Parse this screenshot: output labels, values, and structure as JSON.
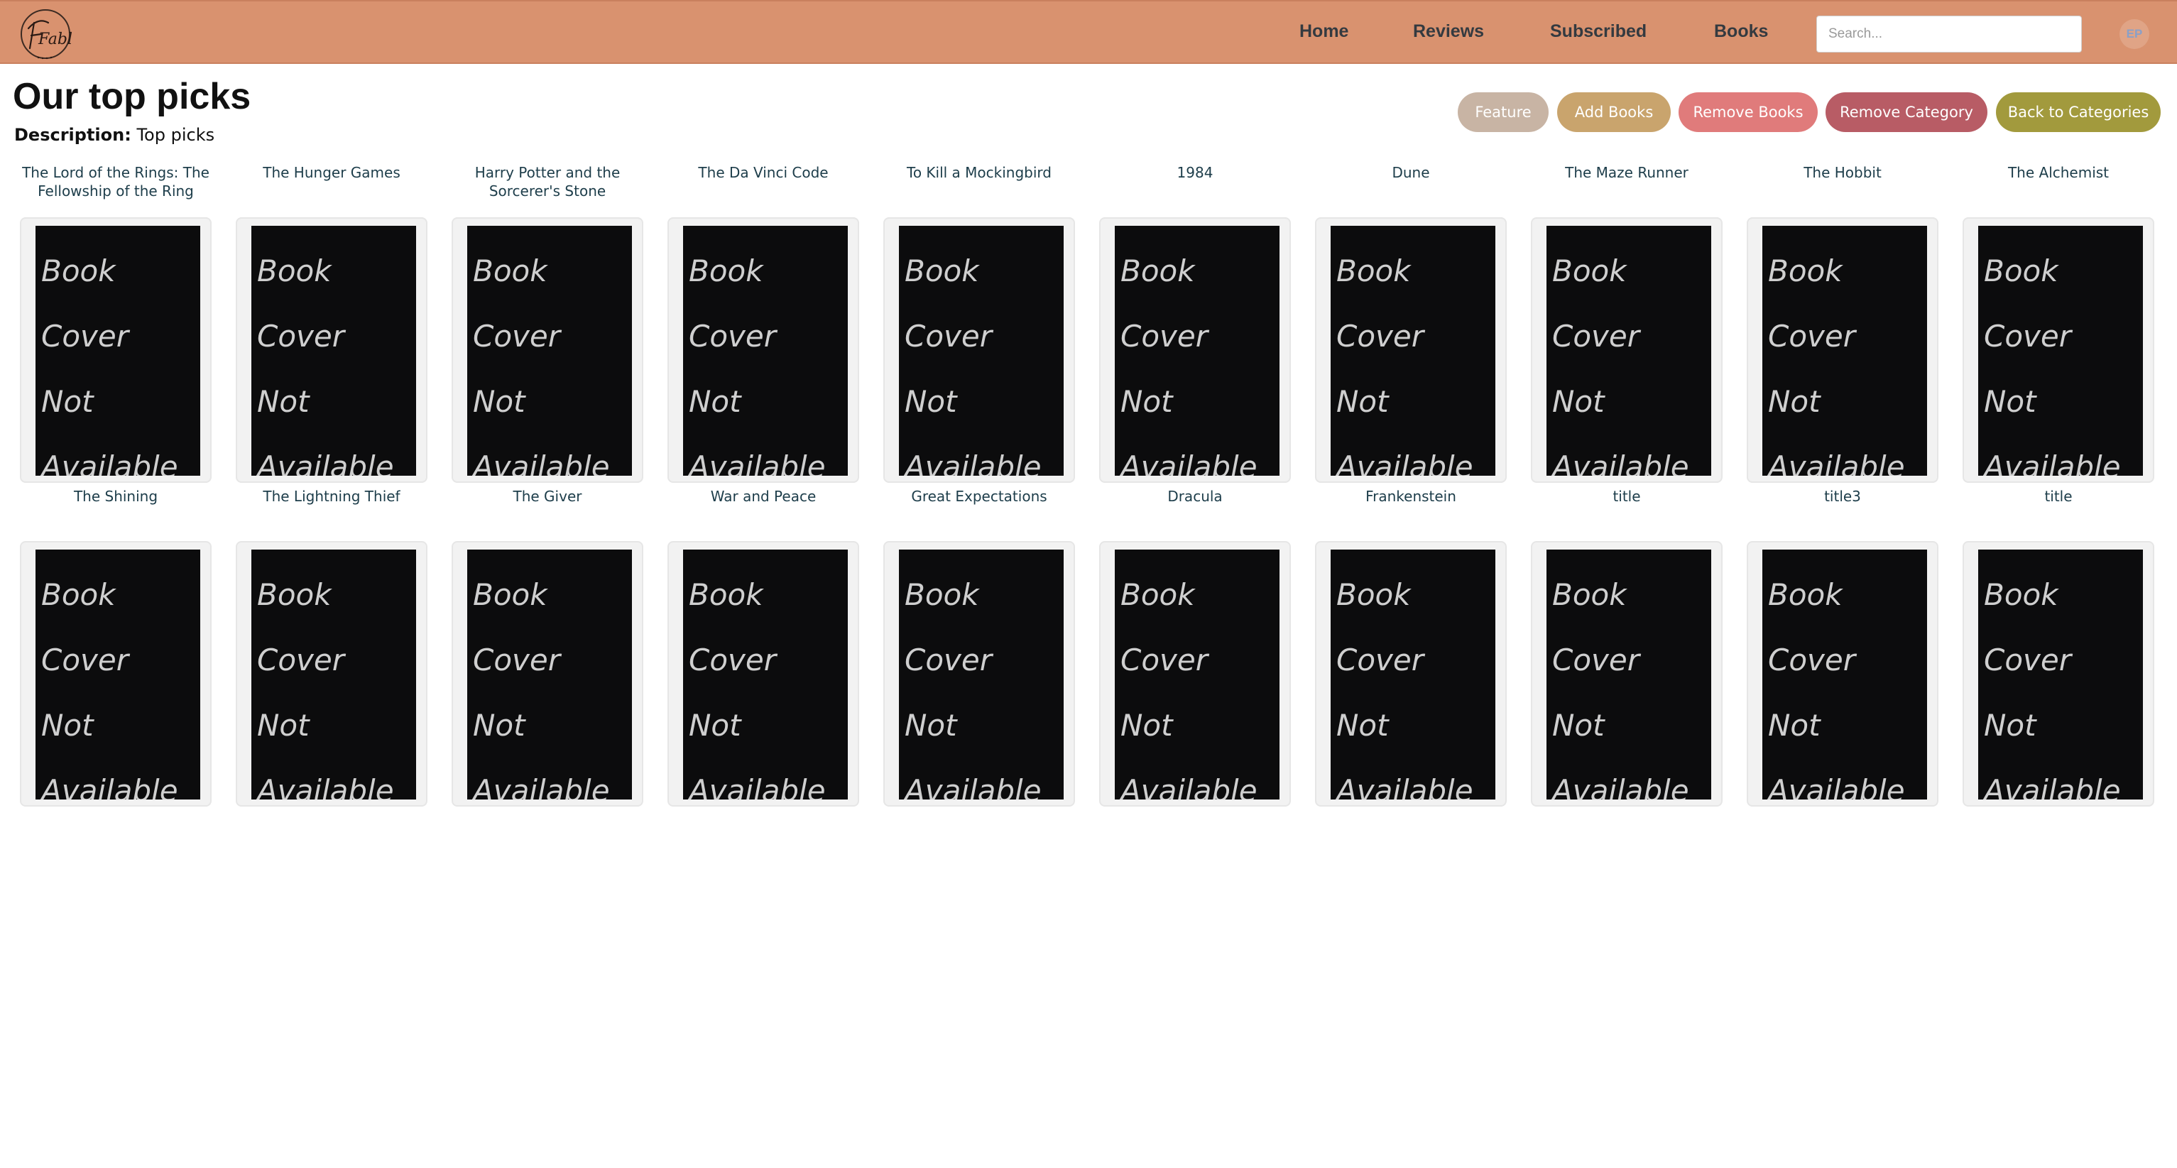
{
  "navbar": {
    "logo_text": "Fabl",
    "links": [
      "Home",
      "Reviews",
      "Subscribed",
      "Books"
    ],
    "search_placeholder": "Search...",
    "avatar_initials": "EP"
  },
  "page": {
    "title": "Our top picks",
    "description_label": "Description:",
    "description_value": "Top picks"
  },
  "actions": {
    "feature": "Feature",
    "add_books": "Add Books",
    "remove_books": "Remove Books",
    "remove_category": "Remove Category",
    "back_to_categories": "Back to Categories"
  },
  "colors": {
    "navbar": "#d9926f",
    "feature": "#c8b4a4",
    "add_books": "#c9a46d",
    "remove_books": "#e07b7b",
    "remove_category": "#b85c65",
    "back_to_categories": "#a29a3d"
  },
  "placeholder_cover_text": "Book Cover\nNot\nAvailable",
  "books": [
    {
      "title": "The Lord of the Rings: The Fellowship of the Ring"
    },
    {
      "title": "The Hunger Games"
    },
    {
      "title": "Harry Potter and the Sorcerer's Stone"
    },
    {
      "title": "The Da Vinci Code"
    },
    {
      "title": "To Kill a Mockingbird"
    },
    {
      "title": "1984"
    },
    {
      "title": "Dune"
    },
    {
      "title": "The Maze Runner"
    },
    {
      "title": "The Hobbit"
    },
    {
      "title": "The Alchemist"
    },
    {
      "title": "The Shining"
    },
    {
      "title": "The Lightning Thief"
    },
    {
      "title": "The Giver"
    },
    {
      "title": "War and Peace"
    },
    {
      "title": "Great Expectations"
    },
    {
      "title": "Dracula"
    },
    {
      "title": "Frankenstein"
    },
    {
      "title": "title"
    },
    {
      "title": "title3"
    },
    {
      "title": "title"
    }
  ]
}
